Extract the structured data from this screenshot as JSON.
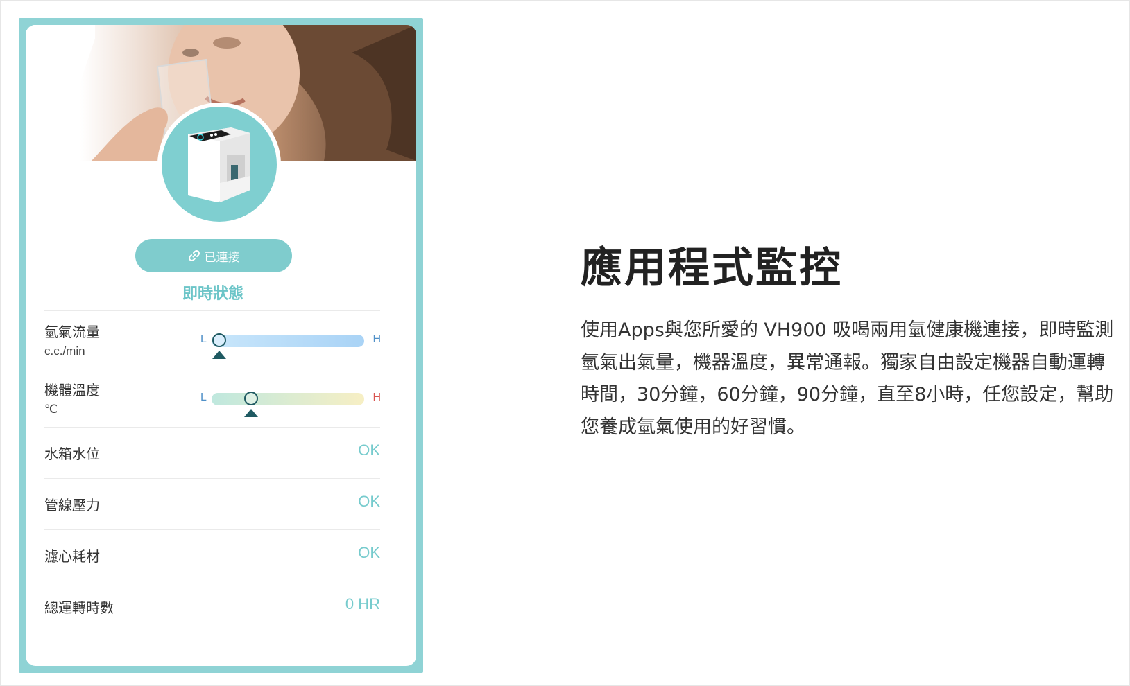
{
  "card": {
    "connect_button": {
      "icon": "link-icon",
      "label": "已連接"
    },
    "section_title": "即時狀態",
    "sliders": [
      {
        "id": "flow",
        "label": "氫氣流量",
        "unit": "c.c./min",
        "low_label": "L",
        "high_label": "H",
        "level": 0.05
      },
      {
        "id": "temp",
        "label": "機體溫度",
        "unit": "℃",
        "low_label": "L",
        "high_label": "H",
        "level": 0.26
      }
    ],
    "status_rows": [
      {
        "label": "水箱水位",
        "value": "OK"
      },
      {
        "label": "管線壓力",
        "value": "OK"
      },
      {
        "label": "濾心耗材",
        "value": "OK"
      },
      {
        "label": "總運轉時數",
        "value": "0 HR"
      }
    ]
  },
  "content": {
    "headline": "應用程式監控",
    "body": "使用Apps與您所愛的 VH900 吸喝兩用氫健康機連接，即時監測氫氣出氣量，機器溫度，異常通報。獨家自由設定機器自動運轉時間，30分鐘，60分鐘，90分鐘，直至8小時，任您設定，幫助您養成氫氣使用的好習慣。"
  },
  "colors": {
    "frame": "#8fd3d5",
    "accent": "#7fcccd",
    "status_ok": "#76cbcd",
    "knob": "#1f5a62",
    "high_temp": "#d9534f",
    "low": "#4f90c8"
  }
}
